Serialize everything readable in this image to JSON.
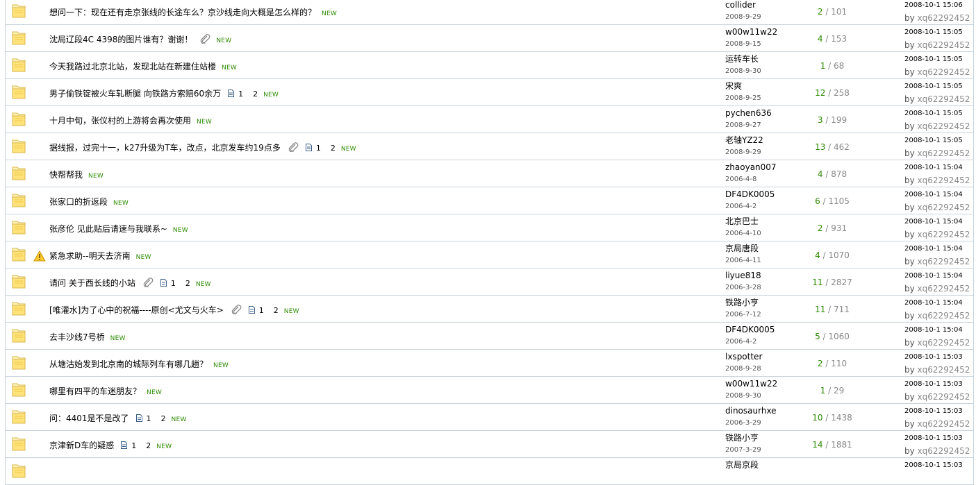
{
  "new_label": "NEW",
  "by_label": "by",
  "threads": [
    {
      "title": "想问一下：现在还有走京张线的长途车么？京沙线走向大概是怎么样的？",
      "attach": false,
      "pages": null,
      "author": "collider",
      "date": "2008-9-29",
      "replies": "2",
      "views": "101",
      "last_time": "2008-10-1 15:06",
      "last_user": "xq62292452",
      "warn": false
    },
    {
      "title": "沈局辽段4C 4398的图片谁有？谢谢！",
      "attach": true,
      "pages": null,
      "author": "w00w11w22",
      "date": "2008-9-15",
      "replies": "4",
      "views": "153",
      "last_time": "2008-10-1 15:05",
      "last_user": "xq62292452",
      "warn": false
    },
    {
      "title": "今天我路过北京北站，发现北站在新建住站楼",
      "attach": false,
      "pages": null,
      "author": "运转车长",
      "date": "2008-9-30",
      "replies": "1",
      "views": "68",
      "last_time": "2008-10-1 15:05",
      "last_user": "xq62292452",
      "warn": false
    },
    {
      "title": "男子偷铁锭被火车轧断腿  向铁路方索赔60余万",
      "attach": false,
      "pages": [
        "1",
        "2"
      ],
      "author": "宋爽",
      "date": "2008-9-25",
      "replies": "12",
      "views": "258",
      "last_time": "2008-10-1 15:05",
      "last_user": "xq62292452",
      "warn": false
    },
    {
      "title": "十月中旬，张仪村的上游将会再次使用",
      "attach": false,
      "pages": null,
      "author": "pychen636",
      "date": "2008-9-27",
      "replies": "3",
      "views": "199",
      "last_time": "2008-10-1 15:05",
      "last_user": "xq62292452",
      "warn": false
    },
    {
      "title": "据线报，过完十一，k27升级为T车，改点，北京发车约19点多",
      "attach": true,
      "pages": [
        "1",
        "2"
      ],
      "author": "老轴YZ22",
      "date": "2008-9-29",
      "replies": "13",
      "views": "462",
      "last_time": "2008-10-1 15:05",
      "last_user": "xq62292452",
      "warn": false
    },
    {
      "title": "快帮帮我",
      "attach": false,
      "pages": null,
      "author": "zhaoyan007",
      "date": "2006-4-8",
      "replies": "4",
      "views": "878",
      "last_time": "2008-10-1 15:04",
      "last_user": "xq62292452",
      "warn": false
    },
    {
      "title": "张家口的折返段",
      "attach": false,
      "pages": null,
      "author": "DF4DK0005",
      "date": "2006-4-2",
      "replies": "6",
      "views": "1105",
      "last_time": "2008-10-1 15:04",
      "last_user": "xq62292452",
      "warn": false
    },
    {
      "title": "张彦伦  见此贴后请速与我联系~",
      "attach": false,
      "pages": null,
      "author": "北京巴士",
      "date": "2006-4-10",
      "replies": "2",
      "views": "931",
      "last_time": "2008-10-1 15:04",
      "last_user": "xq62292452",
      "warn": false
    },
    {
      "title": "紧急求助--明天去济南",
      "attach": false,
      "pages": null,
      "author": "京局唐段",
      "date": "2006-4-11",
      "replies": "4",
      "views": "1070",
      "last_time": "2008-10-1 15:04",
      "last_user": "xq62292452",
      "warn": true
    },
    {
      "title": "请问  关于西长线的小站",
      "attach": true,
      "pages": [
        "1",
        "2"
      ],
      "author": "liyue818",
      "date": "2006-3-28",
      "replies": "11",
      "views": "2827",
      "last_time": "2008-10-1 15:04",
      "last_user": "xq62292452",
      "warn": false
    },
    {
      "title": "[唯灌水]为了心中的祝福----原创<尤文与火车>",
      "attach": true,
      "pages": [
        "1",
        "2"
      ],
      "author": "铁路小亨",
      "date": "2006-7-12",
      "replies": "11",
      "views": "711",
      "last_time": "2008-10-1 15:04",
      "last_user": "xq62292452",
      "warn": false
    },
    {
      "title": "去丰沙线7号桥",
      "attach": false,
      "pages": null,
      "author": "DF4DK0005",
      "date": "2006-4-2",
      "replies": "5",
      "views": "1060",
      "last_time": "2008-10-1 15:04",
      "last_user": "xq62292452",
      "warn": false
    },
    {
      "title": "从塘沽始发到北京南的城际列车有哪几趟？",
      "attach": false,
      "pages": null,
      "author": "lxspotter",
      "date": "2008-9-28",
      "replies": "2",
      "views": "110",
      "last_time": "2008-10-1 15:03",
      "last_user": "xq62292452",
      "warn": false
    },
    {
      "title": "哪里有四平的车迷朋友？",
      "attach": false,
      "pages": null,
      "author": "w00w11w22",
      "date": "2008-9-30",
      "replies": "1",
      "views": "29",
      "last_time": "2008-10-1 15:03",
      "last_user": "xq62292452",
      "warn": false
    },
    {
      "title": "问：4401是不是改了",
      "attach": false,
      "pages": [
        "1",
        "2"
      ],
      "author": "dinosaurhxe",
      "date": "2006-3-29",
      "replies": "10",
      "views": "1438",
      "last_time": "2008-10-1 15:03",
      "last_user": "xq62292452",
      "warn": false
    },
    {
      "title": "京津新D车的疑惑",
      "attach": false,
      "pages": [
        "1",
        "2"
      ],
      "author": "铁路小亨",
      "date": "2007-3-29",
      "replies": "14",
      "views": "1881",
      "last_time": "2008-10-1 15:03",
      "last_user": "xq62292452",
      "warn": false
    },
    {
      "title": "",
      "attach": false,
      "pages": null,
      "author": "京局京段",
      "date": "",
      "replies": "",
      "views": "",
      "last_time": "2008-10-1 15:03",
      "last_user": "",
      "warn": false
    }
  ]
}
